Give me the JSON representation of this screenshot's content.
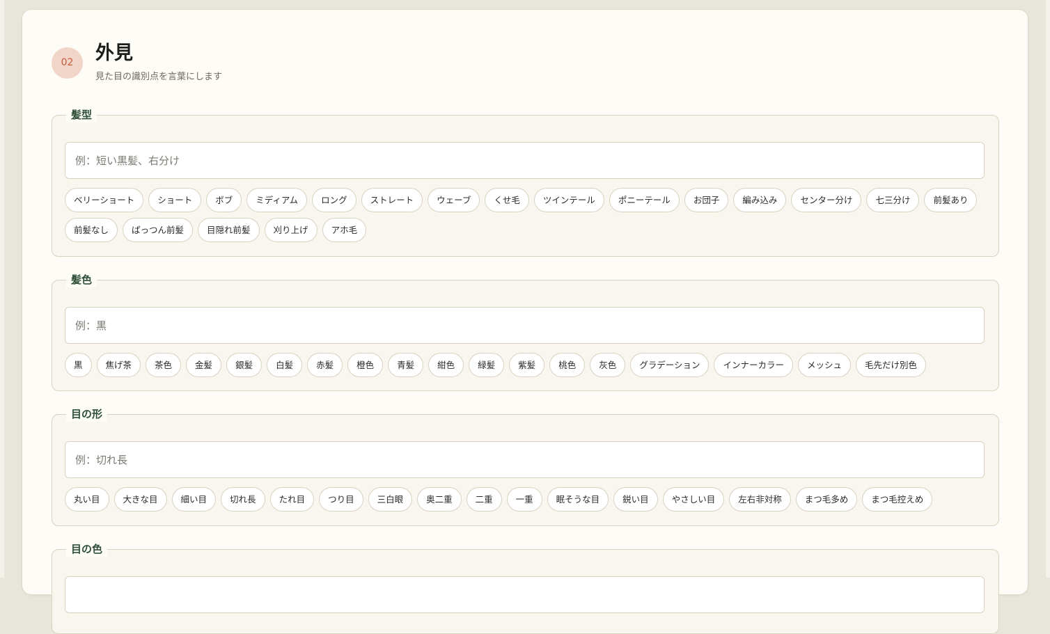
{
  "section": {
    "step": "02",
    "title": "外見",
    "subtitle": "見た目の識別点を言葉にします"
  },
  "groups": {
    "hairstyle": {
      "legend": "髪型",
      "placeholder": "例：短い黒髪、右分け",
      "value": "",
      "chips": [
        "ベリーショート",
        "ショート",
        "ボブ",
        "ミディアム",
        "ロング",
        "ストレート",
        "ウェーブ",
        "くせ毛",
        "ツインテール",
        "ポニーテール",
        "お団子",
        "編み込み",
        "センター分け",
        "七三分け",
        "前髪あり",
        "前髪なし",
        "ぱっつん前髪",
        "目隠れ前髪",
        "刈り上げ",
        "アホ毛"
      ]
    },
    "haircolor": {
      "legend": "髪色",
      "placeholder": "例：黒",
      "value": "",
      "chips": [
        "黒",
        "焦げ茶",
        "茶色",
        "金髪",
        "銀髪",
        "白髪",
        "赤髪",
        "橙色",
        "青髪",
        "紺色",
        "緑髪",
        "紫髪",
        "桃色",
        "灰色",
        "グラデーション",
        "インナーカラー",
        "メッシュ",
        "毛先だけ別色"
      ]
    },
    "eyeshape": {
      "legend": "目の形",
      "placeholder": "例：切れ長",
      "value": "",
      "chips": [
        "丸い目",
        "大きな目",
        "細い目",
        "切れ長",
        "たれ目",
        "つり目",
        "三白眼",
        "奥二重",
        "二重",
        "一重",
        "眠そうな目",
        "鋭い目",
        "やさしい目",
        "左右非対称",
        "まつ毛多め",
        "まつ毛控えめ"
      ]
    },
    "eyecolor": {
      "legend": "目の色",
      "placeholder": "",
      "value": "",
      "chips": []
    }
  },
  "colors": {
    "accent": "#c45a3c",
    "badge_bg": "#f2d5c9",
    "legend": "#2f4f3a",
    "card_bg": "#fdfcf6",
    "group_bg": "#f8f6ee",
    "border": "#d8d2c0"
  }
}
